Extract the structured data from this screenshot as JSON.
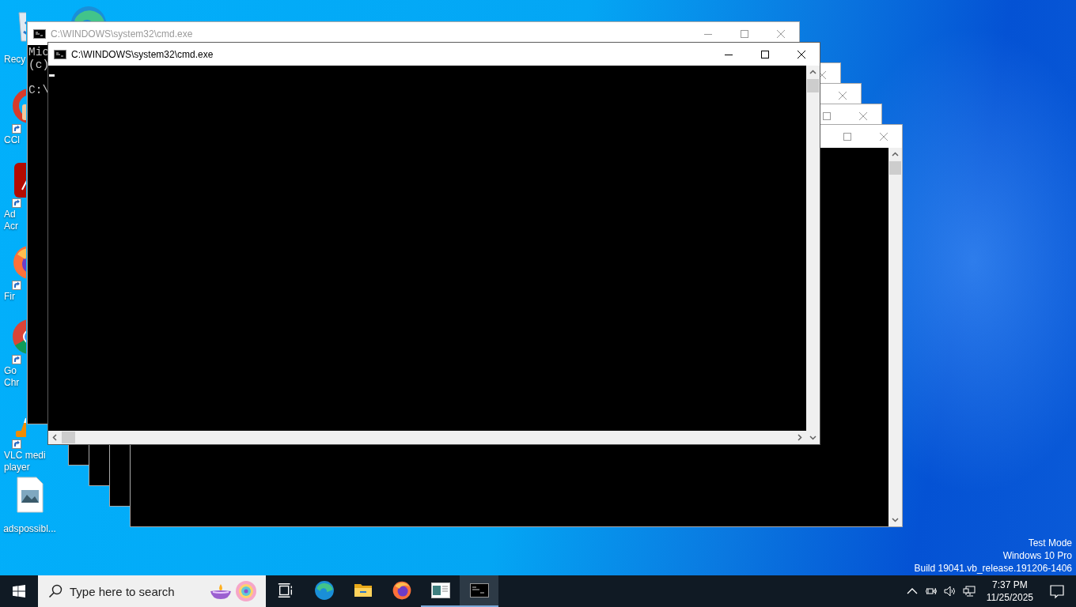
{
  "desktop_icons": [
    {
      "kind": "recycle_bin",
      "shortcut": false,
      "label_lines": [
        "Recy"
      ]
    },
    {
      "kind": "edge"
    },
    {
      "kind": "ccleaner",
      "shortcut": true,
      "label_lines": [
        "CCl"
      ]
    },
    {
      "kind": "acrobat",
      "shortcut": true,
      "label_lines": [
        "Ad",
        "Acr"
      ]
    },
    {
      "kind": "firefox",
      "shortcut": true,
      "label_lines": [
        "Fir"
      ]
    },
    {
      "kind": "chrome",
      "shortcut": true,
      "label_lines": [
        "Go",
        "Chr"
      ]
    },
    {
      "kind": "vlc",
      "shortcut": true,
      "label_lines": [
        "VLC medi",
        "player"
      ]
    },
    {
      "kind": "image_file",
      "shortcut": false,
      "label_lines": [
        "adspossibl..."
      ]
    }
  ],
  "windows": [
    {
      "active": false
    },
    {
      "active": false
    },
    {
      "active": false
    },
    {
      "active": false
    },
    {
      "title": "C:\\WINDOWS\\system32\\cmd.exe",
      "active": false,
      "h_scroll": false,
      "cursor": false,
      "console": [
        [
          "Mic",
          "(c)"
        ],
        [
          "C:\\"
        ]
      ]
    },
    {
      "title": "C:\\WINDOWS\\system32\\cmd.exe",
      "active": true,
      "h_scroll": true,
      "cursor": true
    }
  ],
  "desktop_info": [
    "Test Mode",
    "Windows 10 Pro",
    "Build 19041.vb_release.191206-1406"
  ],
  "taskbar": {
    "search": {
      "placeholder": "Type here to search"
    },
    "apps": [
      {
        "kind": "task_view",
        "running": false,
        "selected": false
      },
      {
        "kind": "edge",
        "running": false,
        "selected": false
      },
      {
        "kind": "explorer",
        "running": false,
        "selected": false
      },
      {
        "kind": "firefox",
        "running": false,
        "selected": false
      },
      {
        "kind": "app_window",
        "running": true,
        "selected": false
      },
      {
        "kind": "terminal",
        "running": true,
        "selected": true
      }
    ],
    "tray": {
      "time": "7:37 PM",
      "date": "11/25/2025"
    }
  }
}
